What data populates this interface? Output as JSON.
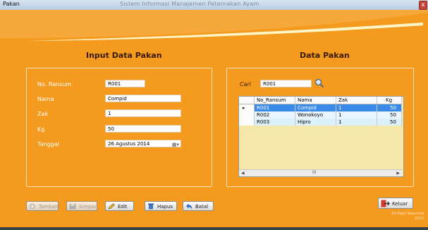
{
  "window": {
    "title": "Pakan",
    "app_title": "Sistem Informasi Manajemen Peternakan Ayam",
    "close": "x"
  },
  "left_panel": {
    "heading": "Input Data Pakan",
    "fields": [
      {
        "label": "No. Ransum",
        "value": "R001"
      },
      {
        "label": "Nama",
        "value": "Compid"
      },
      {
        "label": "Zak",
        "value": "1"
      },
      {
        "label": "Kg",
        "value": "50"
      },
      {
        "label": "Tanggal",
        "value": "26   Agustus   2014"
      }
    ]
  },
  "right_panel": {
    "heading": "Data Pakan",
    "search_label": "Cari",
    "search_value": "R001",
    "table": {
      "columns": [
        "No_Ransum",
        "Nama",
        "Zak",
        "Kg"
      ],
      "rows": [
        [
          "R001",
          "Compid",
          "1",
          "50"
        ],
        [
          "R002",
          "Wonokoyo",
          "1",
          "50"
        ],
        [
          "R003",
          "Hipro",
          "1",
          "50"
        ]
      ],
      "scroll_label": "III"
    }
  },
  "buttons": {
    "tambah": "Tambah",
    "simpan": "Simpan",
    "edit": "Edit",
    "hapus": "Hapus",
    "batal": "Batal",
    "keluar": "Keluar"
  },
  "rights": {
    "line1": "All Right Reserved",
    "line2": "2014"
  },
  "colors": {
    "background": "#f49a1e",
    "selected_row": "#3a8be8",
    "grid_bg": "#f5e7a8"
  },
  "icons": [
    "add-icon",
    "save-icon",
    "edit-icon",
    "delete-icon",
    "undo-icon",
    "exit-icon",
    "search-icon",
    "calendar-icon",
    "row-pointer-icon"
  ]
}
